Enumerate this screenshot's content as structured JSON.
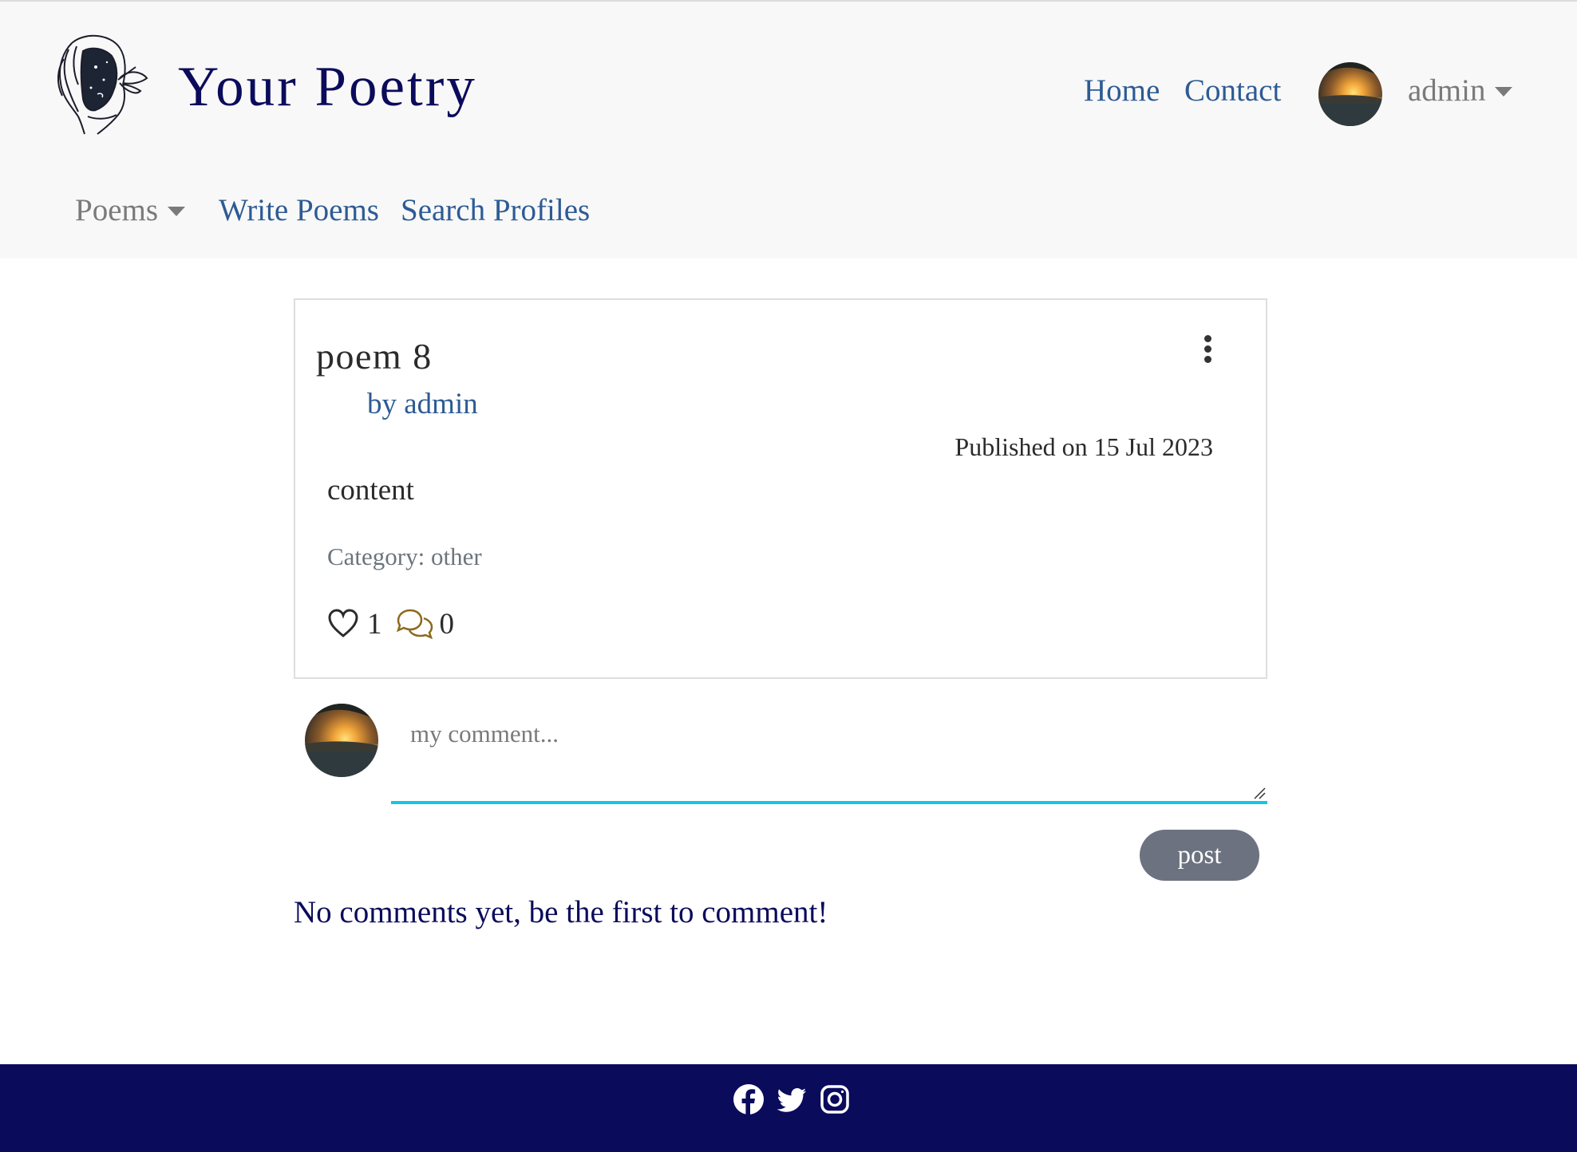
{
  "header": {
    "brand": "Your Poetry",
    "nav": {
      "home": "Home",
      "contact": "Contact"
    },
    "user": {
      "name": "admin"
    },
    "secondary_nav": {
      "poems": "Poems",
      "write": "Write Poems",
      "search": "Search Profiles"
    }
  },
  "poem": {
    "title": "poem 8",
    "author": "by admin",
    "published": "Published on 15 Jul 2023",
    "content": "content",
    "category": "Category: other",
    "likes": "1",
    "comments": "0"
  },
  "comment_form": {
    "placeholder": "my comment...",
    "post_label": "post"
  },
  "comments": {
    "empty_message": "No comments yet, be the first to comment!"
  },
  "footer": {
    "social_icons": [
      "facebook-icon",
      "twitter-icon",
      "instagram-icon"
    ]
  },
  "colors": {
    "brand": "#0b0b5c",
    "link": "#2d5b94",
    "footer_bg": "#0b0b5c",
    "input_underline": "#18c4e3",
    "post_button": "#6c727f",
    "comment_icon": "#8a6a1c"
  }
}
